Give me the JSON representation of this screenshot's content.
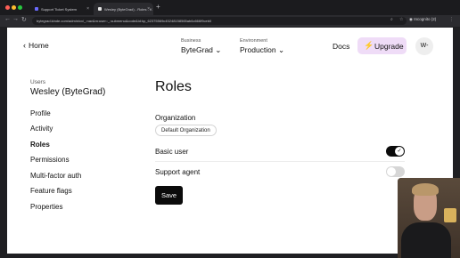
{
  "browser": {
    "tabs": [
      {
        "title": "Support Ticket System",
        "active": false
      },
      {
        "title": "Wesley (ByteGrad) - Roles - K",
        "active": true
      }
    ],
    "url": "bytegrad.kinde.com/admin/cx/_:nav&m:user::_:submenu&code&id:kp_62375569c45248158565ab6c666f9ceb0",
    "incognito_label": "Incognito (2)"
  },
  "header": {
    "back_label": "Home",
    "business_label": "Business",
    "business_value": "ByteGrad",
    "environment_label": "Environment",
    "environment_value": "Production",
    "docs_label": "Docs",
    "upgrade_label": "Upgrade",
    "avatar_initials": "W-"
  },
  "sidebar": {
    "section_label": "Users",
    "user_name": "Wesley (ByteGrad)",
    "items": [
      {
        "label": "Profile",
        "active": false
      },
      {
        "label": "Activity",
        "active": false
      },
      {
        "label": "Roles",
        "active": true
      },
      {
        "label": "Permissions",
        "active": false
      },
      {
        "label": "Multi-factor auth",
        "active": false
      },
      {
        "label": "Feature flags",
        "active": false
      },
      {
        "label": "Properties",
        "active": false
      }
    ]
  },
  "main": {
    "title": "Roles",
    "organization_label": "Organization",
    "organization_chip": "Default Organization",
    "roles": [
      {
        "label": "Basic user",
        "enabled": true
      },
      {
        "label": "Support agent",
        "enabled": false
      }
    ],
    "save_label": "Save"
  },
  "colors": {
    "accent": "#a01ad6",
    "upgrade_bg": "#efdcf7",
    "toggle_on": "#0b0b0b",
    "toggle_off": "#d6d6d6",
    "button_bg": "#0b0b0b"
  }
}
